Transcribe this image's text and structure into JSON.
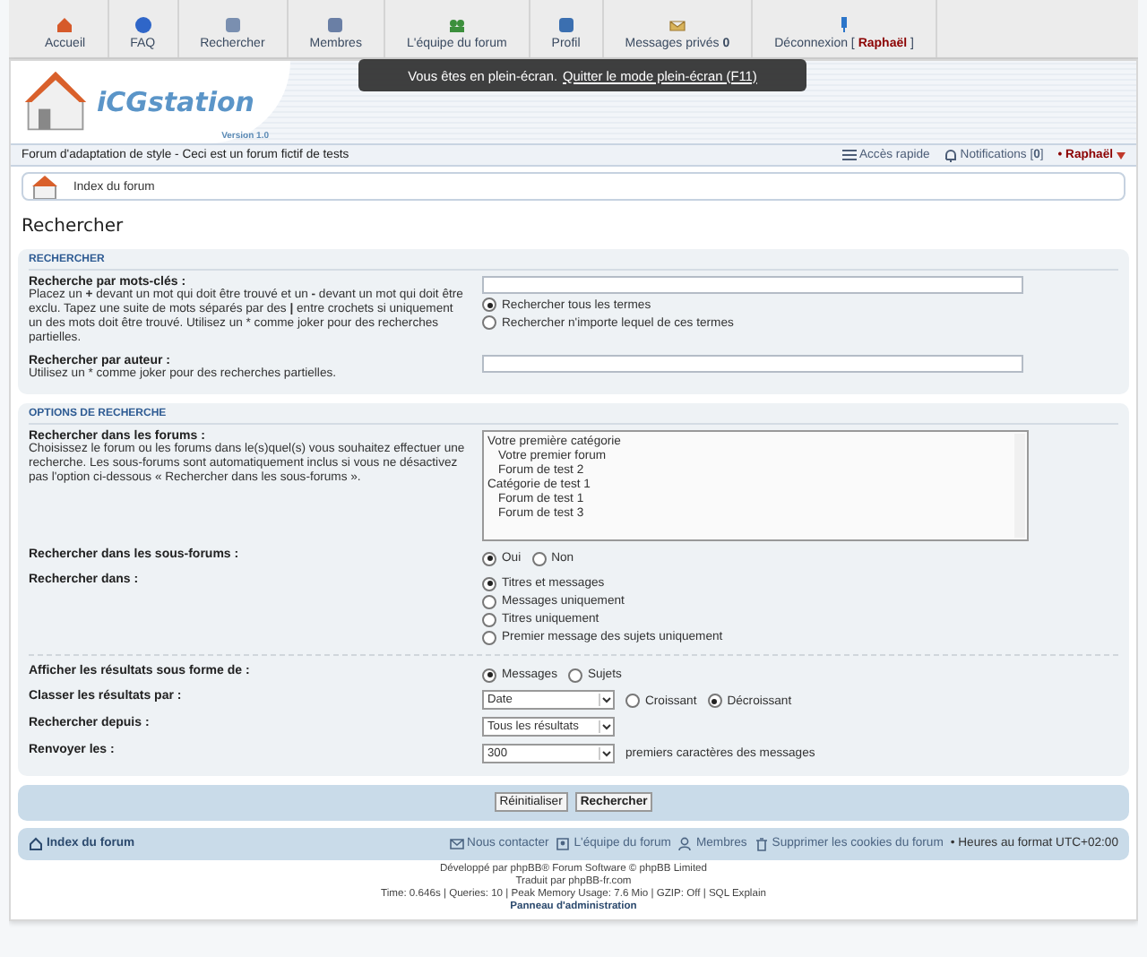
{
  "top_nav": [
    {
      "kind": "home",
      "label": "Accueil"
    },
    {
      "kind": "faq",
      "label": "FAQ"
    },
    {
      "kind": "search",
      "label": "Rechercher"
    },
    {
      "kind": "members",
      "label": "Membres"
    },
    {
      "kind": "team",
      "label": "L'équipe du forum"
    },
    {
      "kind": "profile",
      "label": "Profil"
    },
    {
      "kind": "messages",
      "label": "Messages privés **0**"
    },
    {
      "kind": "logout",
      "label": "Déconnexion [ **Raphaël** ]"
    }
  ],
  "fullscreen_notice": {
    "text": "Vous êtes en plein-écran.",
    "link": "Quitter le mode plein-écran (F11)"
  },
  "header": {
    "site_name": "iCGstation",
    "version": "Version 1.0",
    "description": "Forum d'adaptation de style - Ceci est un forum fictif de tests"
  },
  "user_bar": {
    "quick_access": "Accès rapide",
    "notifications": "Notifications [**0**]",
    "user": "• Raphaël"
  },
  "breadcrumb": "Index du forum",
  "page_title": "Rechercher",
  "search_panel": {
    "heading": "RECHERCHER",
    "keywords": {
      "label": "Recherche par mots-clés :",
      "help": "Placez un **+** devant un mot qui doit être trouvé et un **-** devant un mot qui doit être exclu. Tapez une suite de mots séparés par des **|** entre crochets si uniquement un des mots doit être trouvé. Utilisez un * comme joker pour des recherches partielles.",
      "options": [
        {
          "label": "Rechercher tous les termes",
          "selected": true
        },
        {
          "label": "Rechercher n'importe lequel de ces termes",
          "selected": false
        }
      ]
    },
    "author": {
      "label": "Rechercher par auteur :",
      "help": "Utilisez un * comme joker pour des recherches partielles."
    }
  },
  "options_panel": {
    "heading": "OPTIONS DE RECHERCHE",
    "forums": {
      "label": "Rechercher dans les forums :",
      "help": "Choisissez le forum ou les forums dans le(s)quel(s) vous souhaitez effectuer une recherche. Les sous-forums sont automatiquement inclus si vous ne désactivez pas l'option ci-dessous « Rechercher dans les sous-forums ».",
      "items": [
        {
          "label": "Votre première catégorie",
          "children": [
            {
              "label": "Votre premier forum"
            },
            {
              "label": "Forum de test 2"
            }
          ]
        },
        {
          "label": "Catégorie de test 1",
          "children": [
            {
              "label": "Forum de test 1"
            },
            {
              "label": "Forum de test 3"
            }
          ]
        }
      ]
    },
    "subforums": {
      "label": "Rechercher dans les sous-forums :",
      "options": [
        {
          "label": "Oui",
          "selected": true
        },
        {
          "label": "Non",
          "selected": false
        }
      ]
    },
    "search_in": {
      "label": "Rechercher dans :",
      "options": [
        {
          "label": "Titres et messages",
          "selected": true
        },
        {
          "label": "Messages uniquement",
          "selected": false
        },
        {
          "label": "Titres uniquement",
          "selected": false
        },
        {
          "label": "Premier message des sujets uniquement",
          "selected": false
        }
      ]
    },
    "display_as": {
      "label": "Afficher les résultats sous forme de :",
      "options": [
        {
          "label": "Messages",
          "selected": true
        },
        {
          "label": "Sujets",
          "selected": false
        }
      ]
    },
    "sort_by": {
      "label": "Classer les résultats par :",
      "value": "Date",
      "options": [
        {
          "label": "Croissant",
          "selected": false
        },
        {
          "label": "Décroissant",
          "selected": true
        }
      ]
    },
    "since": {
      "label": "Rechercher depuis :",
      "value": "Tous les résultats"
    },
    "return": {
      "label": "Renvoyer les :",
      "value": "300",
      "suffix": "premiers caractères des messages"
    }
  },
  "buttons": [
    {
      "label": "Réinitialiser",
      "primary": false
    },
    {
      "label": "Rechercher",
      "primary": true
    }
  ],
  "footer_bar": {
    "index": "Index du forum",
    "links": [
      {
        "kind": "contact",
        "label": "Nous contacter"
      },
      {
        "kind": "team",
        "label": "L'équipe du forum"
      },
      {
        "kind": "members",
        "label": "Membres"
      },
      {
        "kind": "cookies",
        "label": "Supprimer les cookies du forum"
      }
    ],
    "timezone": "• Heures au format UTC+02:00"
  },
  "credits": [
    "Développé par phpBB® Forum Software © phpBB Limited",
    "Traduit par phpBB-fr.com",
    "Time: 0.646s | Queries: 10 | Peak Memory Usage: 7.6 Mio | GZIP: Off | SQL Explain"
  ],
  "admin_link": "Panneau d'administration"
}
